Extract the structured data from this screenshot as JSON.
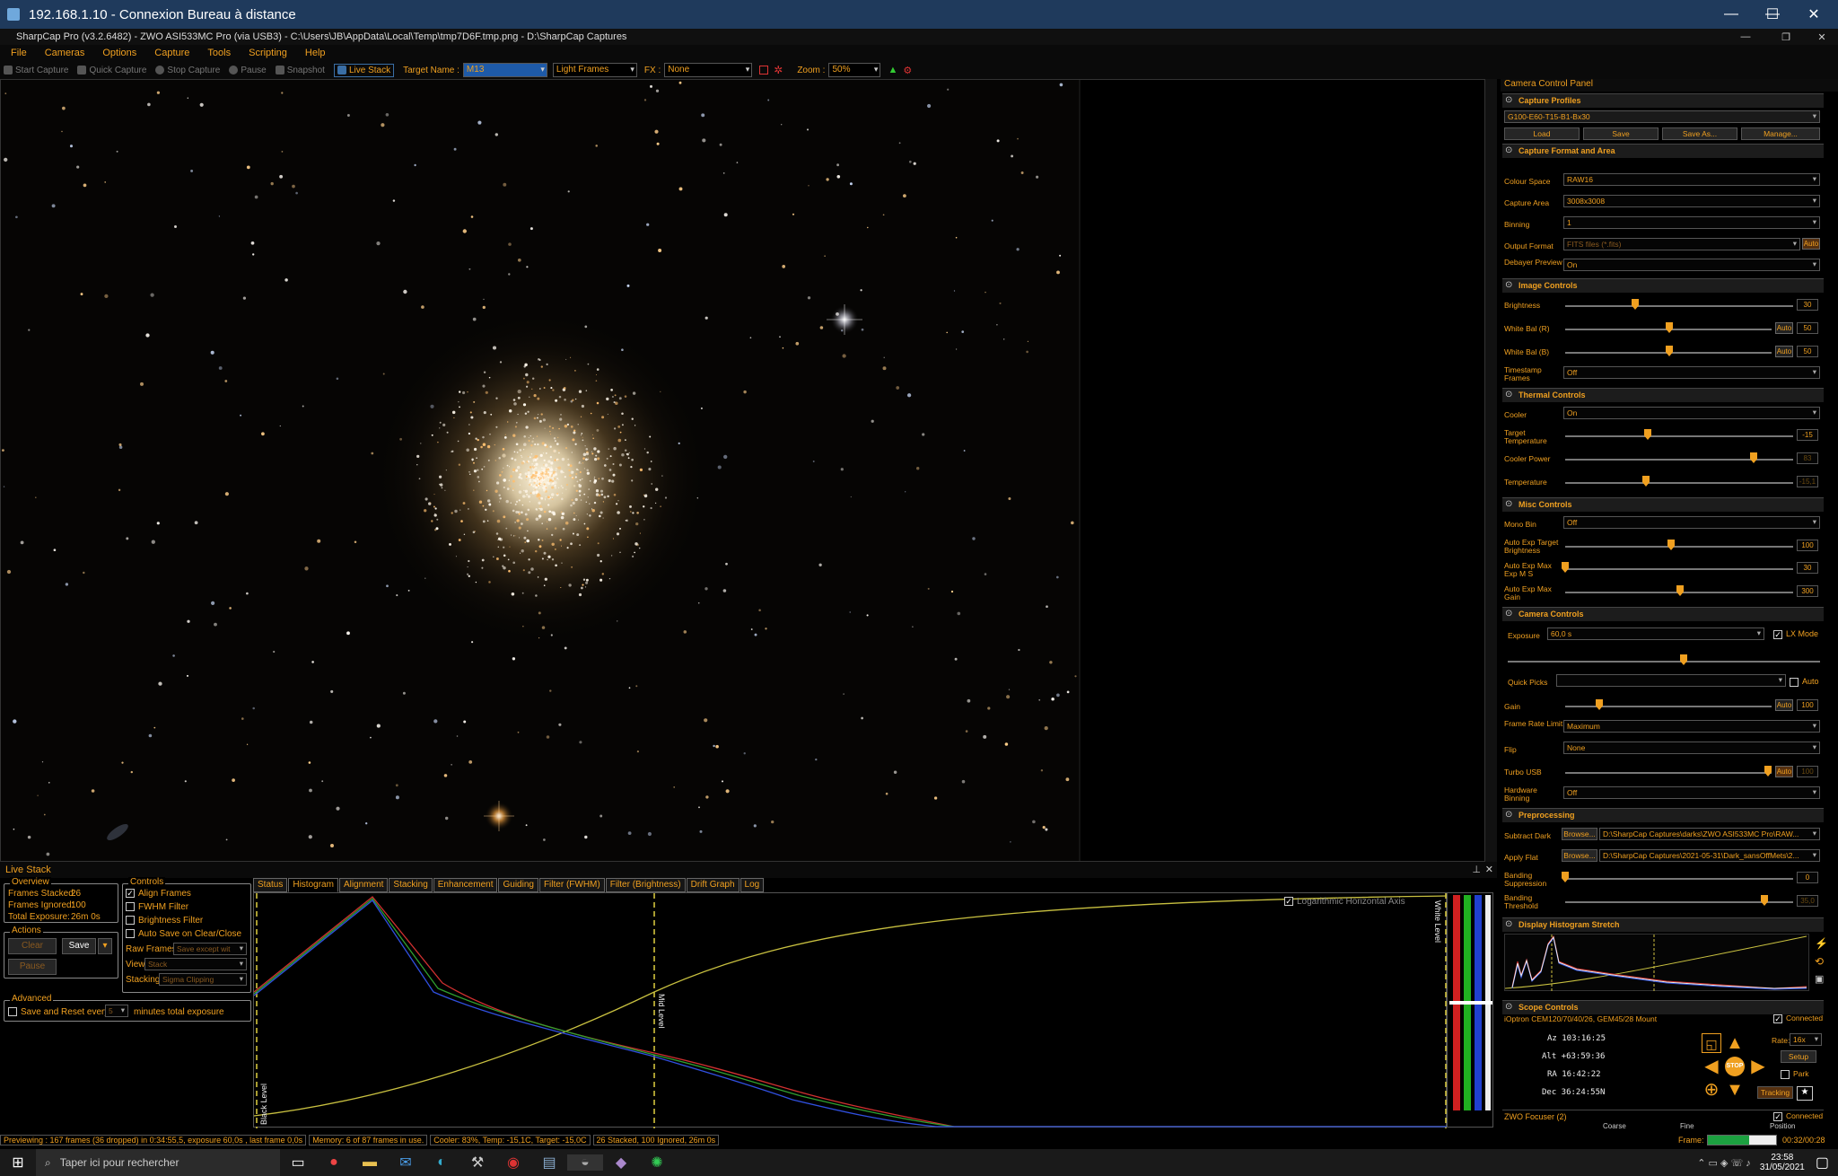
{
  "rdp": {
    "title": "192.168.1.10 - Connexion Bureau à distance",
    "min": "—",
    "max": "☐",
    "close": "✕"
  },
  "app": {
    "title": "SharpCap Pro (v3.2.6482) - ZWO ASI533MC Pro (via USB3) - C:\\Users\\JB\\AppData\\Local\\Temp\\tmp7D6F.tmp.png - D:\\SharpCap Captures"
  },
  "menu": [
    "File",
    "Cameras",
    "Options",
    "Capture",
    "Tools",
    "Scripting",
    "Help"
  ],
  "toolbar": {
    "start_capture": "Start Capture",
    "quick_capture": "Quick Capture",
    "stop_capture": "Stop Capture",
    "pause": "Pause",
    "snapshot": "Snapshot",
    "live_stack": "Live Stack",
    "target_name_label": "Target Name :",
    "target_name": "M13",
    "frame_type": "Light Frames",
    "fx_label": "FX :",
    "fx": "None",
    "zoom_label": "Zoom :",
    "zoom": "50%"
  },
  "live_stack": {
    "title": "Live Stack",
    "overview": {
      "legend": "Overview",
      "frames_stacked_label": "Frames Stacked:",
      "frames_stacked": "26",
      "frames_ignored_label": "Frames Ignored:",
      "frames_ignored": "100",
      "total_exposure_label": "Total Exposure:",
      "total_exposure": "26m 0s"
    },
    "actions": {
      "legend": "Actions",
      "clear": "Clear",
      "save": "Save",
      "pause": "Pause"
    },
    "controls": {
      "legend": "Controls",
      "align_frames": "Align Frames",
      "fwhm_filter": "FWHM Filter",
      "brightness_filter": "Brightness Filter",
      "auto_save": "Auto Save on Clear/Close",
      "raw_frames_label": "Raw Frames",
      "raw_frames": "Save except wit",
      "view_label": "View",
      "view": "Stack",
      "stacking_label": "Stacking",
      "stacking": "Sigma Clipping"
    },
    "advanced": {
      "legend": "Advanced",
      "save_reset": "Save and Reset every",
      "minutes": "minutes total exposure",
      "minutes_value": "5"
    },
    "tabs": [
      "Status",
      "Histogram",
      "Alignment",
      "Stacking",
      "Enhancement",
      "Guiding",
      "Filter (FWHM)",
      "Filter (Brightness)",
      "Drift Graph",
      "Log"
    ],
    "active_tab": "Histogram",
    "histogram": {
      "log_axis": "Logarithmic Horizontal Axis",
      "black_level": "Black Level",
      "mid_level": "Mid Level",
      "white_level": "White Level"
    }
  },
  "status": {
    "preview": "Previewing : 167 frames (36 dropped) in 0:34:55,5, exposure 60,0s , last frame 0,0s",
    "memory": "Memory: 6 of 87 frames in use.",
    "cooler": "Cooler: 83%, Temp: -15,1C, Target: -15,0C",
    "stacked": "26 Stacked, 100 Ignored, 26m 0s"
  },
  "taskbar": {
    "search": "Taper ici pour rechercher",
    "time": "23:58",
    "date": "31/05/2021"
  },
  "panel": {
    "title": "Camera Control Panel",
    "capture_profiles": {
      "title": "Capture Profiles",
      "profile": "G100-E60-T15-B1-Bx30",
      "load": "Load",
      "save": "Save",
      "save_as": "Save As...",
      "manage": "Manage..."
    },
    "capture_format": {
      "title": "Capture Format and Area",
      "colour_space_label": "Colour Space",
      "colour_space": "RAW16",
      "capture_area_label": "Capture Area",
      "capture_area": "3008x3008",
      "binning_label": "Binning",
      "binning": "1",
      "output_format_label": "Output Format",
      "output_format": "FITS files (*.fits)",
      "auto": "Auto",
      "debayer_label": "Debayer Preview",
      "debayer": "On"
    },
    "image_controls": {
      "title": "Image Controls",
      "brightness_label": "Brightness",
      "brightness": "30",
      "wb_r_label": "White Bal (R)",
      "wb_r": "50",
      "wb_b_label": "White Bal (B)",
      "wb_b": "50",
      "timestamp_label": "Timestamp Frames",
      "timestamp": "Off",
      "auto": "Auto"
    },
    "thermal": {
      "title": "Thermal Controls",
      "cooler_label": "Cooler",
      "cooler": "On",
      "target_label": "Target Temperature",
      "target": "-15",
      "power_label": "Cooler Power",
      "power": "83",
      "temp_label": "Temperature",
      "temp": "-15,1"
    },
    "misc": {
      "title": "Misc Controls",
      "mono_label": "Mono Bin",
      "mono": "Off",
      "aet_label": "Auto Exp Target Brightness",
      "aet": "100",
      "aem_label": "Auto Exp Max Exp M S",
      "aem": "30",
      "aeg_label": "Auto Exp Max Gain",
      "aeg": "300"
    },
    "camera": {
      "title": "Camera Controls",
      "exposure_label": "Exposure",
      "exposure": "60,0 s",
      "lx_mode": "LX Mode",
      "quick_picks_label": "Quick Picks",
      "auto": "Auto",
      "gain_label": "Gain",
      "gain": "100",
      "frame_rate_label": "Frame Rate Limit",
      "frame_rate": "Maximum",
      "flip_label": "Flip",
      "flip": "None",
      "turbo_label": "Turbo USB",
      "turbo": "100",
      "hw_bin_label": "Hardware Binning",
      "hw_bin": "Off"
    },
    "preprocessing": {
      "title": "Preprocessing",
      "dark_label": "Subtract Dark",
      "dark": "D:\\SharpCap Captures\\darks\\ZWO ASI533MC Pro\\RAW...",
      "flat_label": "Apply Flat",
      "flat": "D:\\SharpCap Captures\\2021-05-31\\Dark_sansOffMets\\2...",
      "browse": "Browse...",
      "banding_supp_label": "Banding Suppression",
      "banding_supp": "0",
      "banding_thr_label": "Banding Threshold",
      "banding_thr": "35,0"
    },
    "histogram_stretch": {
      "title": "Display Histogram Stretch"
    },
    "scope": {
      "title": "Scope Controls",
      "connected": "Connected",
      "mount": "iOptron CEM120/70/40/26, GEM45/28 Mount",
      "az": "Az  103:16:25",
      "alt": "Alt +63:59:36",
      "ra": "RA  16:42:22",
      "dec": "Dec 36:24:55N",
      "rate_label": "Rate:",
      "rate": "16x",
      "setup": "Setup",
      "park": "Park",
      "tracking": "Tracking",
      "stop": "STOP"
    },
    "focuser": {
      "title": "ZWO Focuser (2)",
      "connected": "Connected",
      "coarse": "Coarse",
      "fine": "Fine",
      "position": "Position",
      "frame_label": "Frame:",
      "frame_time": "00:32/00:28"
    }
  },
  "colors": {
    "accent": "#f0a020",
    "rdp_bar": "#1f3a5c"
  }
}
